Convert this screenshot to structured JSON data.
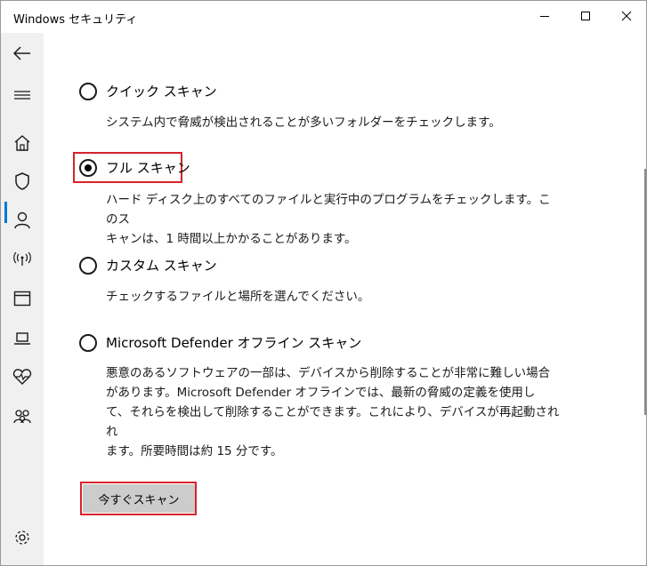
{
  "window": {
    "title": "Windows セキュリティ"
  },
  "sidebar": {
    "items": [
      {
        "icon": "back-arrow-icon"
      },
      {
        "icon": "hamburger-menu-icon"
      },
      {
        "icon": "home-icon"
      },
      {
        "icon": "shield-icon"
      },
      {
        "icon": "person-icon"
      },
      {
        "icon": "wireless-icon"
      },
      {
        "icon": "app-browser-icon"
      },
      {
        "icon": "laptop-icon"
      },
      {
        "icon": "heart-health-icon"
      },
      {
        "icon": "family-icon"
      },
      {
        "icon": "gear-icon"
      }
    ],
    "active_item": "shield-icon",
    "accent_color": "#0078d7"
  },
  "scan_options": [
    {
      "label": "クイック スキャン",
      "description": "システム内で脅威が検出されることが多いフォルダーをチェックします。",
      "selected": false
    },
    {
      "label": "フル スキャン",
      "description_lines": [
        "ハード ディスク上のすべてのファイルと実行中のプログラムをチェックします。このス",
        "キャンは、1 時間以上かかることがあります。"
      ],
      "selected": true
    },
    {
      "label": "カスタム スキャン",
      "description": "チェックするファイルと場所を選んでください。",
      "selected": false
    },
    {
      "label": "Microsoft Defender オフライン スキャン",
      "description_lines": [
        "悪意のあるソフトウェアの一部は、デバイスから削除することが非常に難しい場合",
        "があります。Microsoft Defender オフラインでは、最新の脅威の定義を使用し",
        "て、それらを検出して削除することができます。これにより、デバイスが再起動されれ",
        "ます。所要時間は約 15 分です。"
      ],
      "selected": false
    }
  ],
  "scan_now_button": {
    "label": "今すぐスキャン"
  },
  "highlight_color": "#d9222a"
}
